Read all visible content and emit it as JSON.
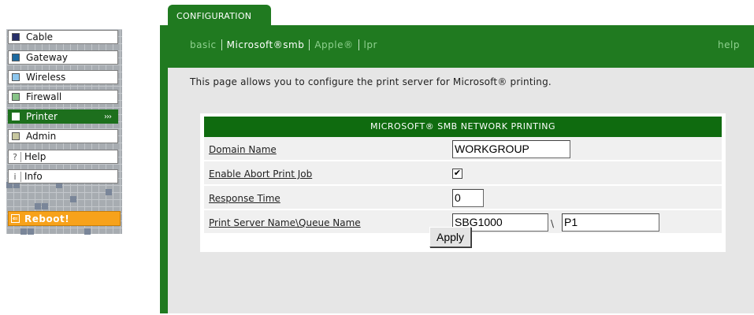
{
  "sidebar": {
    "items": [
      {
        "label": "Cable",
        "color": "#28306a"
      },
      {
        "label": "Gateway",
        "color": "#1d6aa0"
      },
      {
        "label": "Wireless",
        "color": "#8ec7ee"
      },
      {
        "label": "Firewall",
        "color": "#88c488"
      },
      {
        "label": "Printer",
        "color": "#ffffff",
        "active": true,
        "chevron": "›››"
      },
      {
        "label": "Admin",
        "color": "#c8c8a0"
      },
      {
        "label": "Help",
        "glyph": "?"
      },
      {
        "label": "Info",
        "glyph": "i"
      }
    ],
    "reboot_label": "Reboot!",
    "reboot_icon": "⇐"
  },
  "tab": {
    "label": "CONFIGURATION"
  },
  "subnav": {
    "links": [
      "basic",
      "Microsoft®smb",
      "Apple®",
      "lpr"
    ],
    "active_index": 1,
    "help_label": "help"
  },
  "intro": "This page allows you to configure the print server for Microsoft® printing.",
  "smb": {
    "header": "MICROSOFT® SMB NETWORK PRINTING",
    "domain_label": "Domain Name",
    "domain_value": "WORKGROUP",
    "abort_label": "Enable Abort Print Job",
    "abort_checked": "✔",
    "response_label": "Response Time",
    "response_value": "0",
    "print_label": "Print Server Name\\Queue Name",
    "server_value": "SBG1000",
    "separator": "\\",
    "queue_value": "P1"
  },
  "apply_label": "Apply",
  "colors": {
    "green": "#207a20",
    "header_green": "#0f6b0f",
    "reboot": "#f7a21b",
    "panel_grey": "#e6e6e6"
  }
}
